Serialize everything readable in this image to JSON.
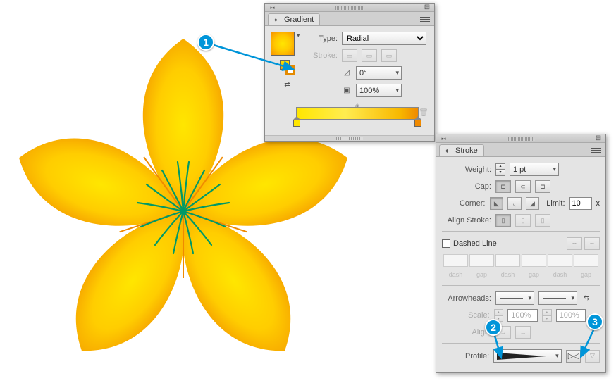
{
  "badges": {
    "one": "1",
    "two": "2",
    "three": "3"
  },
  "gradient_panel": {
    "tab": "Gradient",
    "type_label": "Type:",
    "type_value": "Radial",
    "stroke_label": "Stroke:",
    "angle_value": "0°",
    "opacity_value": "100%",
    "stops": [
      {
        "pos": 0,
        "color": "#ffe600"
      },
      {
        "pos": 100,
        "color": "#f08a00"
      }
    ]
  },
  "stroke_panel": {
    "tab": "Stroke",
    "weight_label": "Weight:",
    "weight_value": "1 pt",
    "cap_label": "Cap:",
    "corner_label": "Corner:",
    "limit_label": "Limit:",
    "limit_value": "10",
    "limit_unit": "x",
    "align_label": "Align Stroke:",
    "dashed_label": "Dashed Line",
    "dash_labels": [
      "dash",
      "gap",
      "dash",
      "gap",
      "dash",
      "gap"
    ],
    "arrow_label": "Arrowheads:",
    "scale_label": "Scale:",
    "scale_a": "100%",
    "scale_b": "100%",
    "align2_label": "Align:",
    "profile_label": "Profile:",
    "flip": "▷◁"
  },
  "colors": {
    "accent": "#0095d9",
    "flower_inner": "#ffe600",
    "flower_outer": "#f39800",
    "stamen": "#009966"
  }
}
